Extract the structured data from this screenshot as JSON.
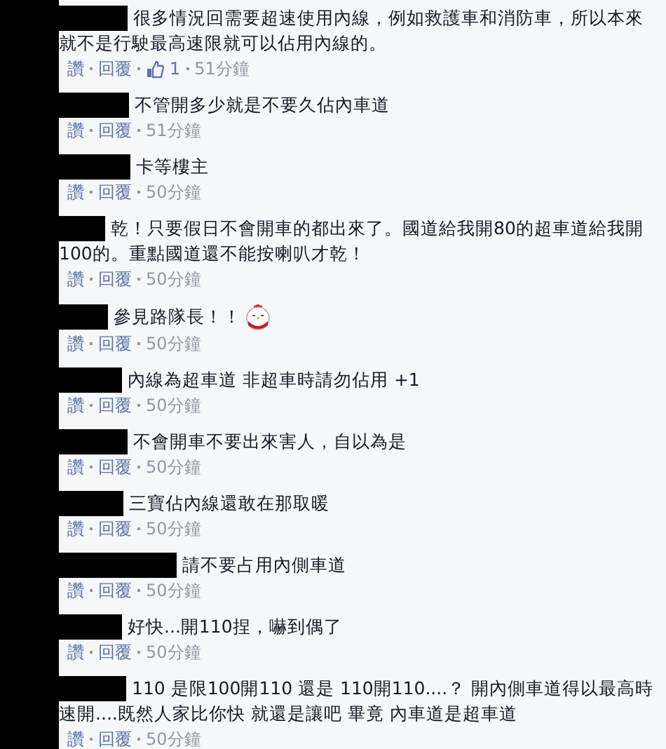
{
  "comments": [
    {
      "text": "很多情況回需要超速使用內線，例如救護車和消防車，所以本來就不是行駛最高速限就可以佔用內線的。",
      "actions": [
        "讚",
        "回覆"
      ],
      "likes": "1",
      "time": "51分鐘"
    },
    {
      "text": "不管開多少就是不要久佔內車道",
      "actions": [
        "讚",
        "回覆"
      ],
      "time": "51分鐘"
    },
    {
      "text": "卡等樓主",
      "actions": [
        "讚",
        "回覆"
      ],
      "time": "50分鐘"
    },
    {
      "text": "乾！只要假日不會開車的都出來了。國道給我開80的超車道給我開100的。重點國道還不能按喇叭才乾！",
      "actions": [
        "讚",
        "回覆"
      ],
      "time": "50分鐘"
    },
    {
      "text": "參見路隊長！！",
      "sticker": true,
      "actions": [
        "讚",
        "回覆"
      ],
      "time": "50分鐘"
    },
    {
      "text": "內線為超車道 非超車時請勿佔用 +1",
      "actions": [
        "讚",
        "回覆"
      ],
      "time": "50分鐘"
    },
    {
      "text": "不會開車不要出來害人，自以為是",
      "actions": [
        "讚",
        "回覆"
      ],
      "time": "50分鐘"
    },
    {
      "text": "三寶佔內線還敢在那取暖",
      "actions": [
        "讚",
        "回覆"
      ],
      "time": "50分鐘"
    },
    {
      "text": "請不要占用內側車道",
      "actions": [
        "讚",
        "回覆"
      ],
      "time": "50分鐘"
    },
    {
      "text": "好快...開110捏，嚇到偶了",
      "actions": [
        "讚",
        "回覆"
      ],
      "time": "50分鐘"
    },
    {
      "text": "110 是限100開110 還是 110開110....？ 開內側車道得以最高時速開....既然人家比你快 就還是讓吧 畢竟 內車道是超車道",
      "actions": [
        "讚",
        "回覆"
      ],
      "time": "50分鐘"
    }
  ]
}
